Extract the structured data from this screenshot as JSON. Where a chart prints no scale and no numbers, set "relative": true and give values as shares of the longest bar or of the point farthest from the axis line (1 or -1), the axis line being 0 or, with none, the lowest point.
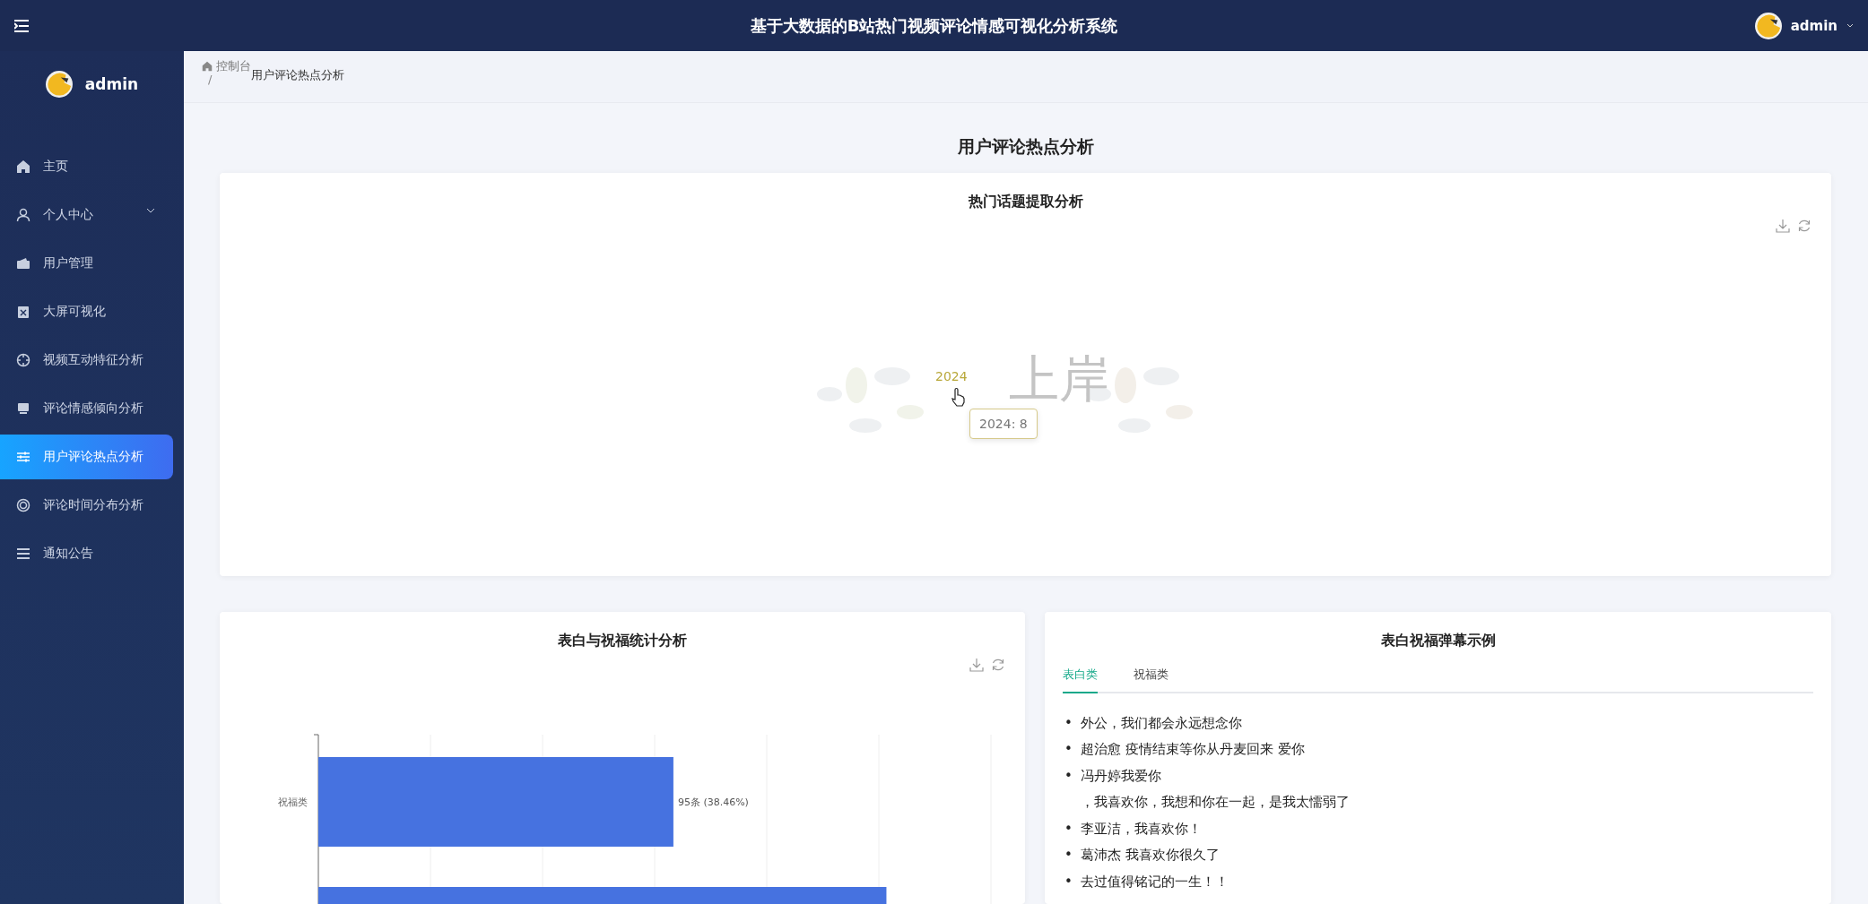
{
  "header": {
    "title": "基于大数据的B站热门视频评论情感可视化分析系统",
    "user": "admin"
  },
  "sidebar": {
    "user": "admin",
    "items": [
      {
        "label": "主页",
        "selected": false
      },
      {
        "label": "个人中心",
        "selected": false,
        "expandable": true
      },
      {
        "label": "用户管理",
        "selected": false
      },
      {
        "label": "大屏可视化",
        "selected": false
      },
      {
        "label": "视频互动特征分析",
        "selected": false
      },
      {
        "label": "评论情感倾向分析",
        "selected": false
      },
      {
        "label": "用户评论热点分析",
        "selected": true
      },
      {
        "label": "评论时间分布分析",
        "selected": false
      },
      {
        "label": "通知公告",
        "selected": false
      }
    ]
  },
  "breadcrumb": {
    "home": "控制台",
    "separator": "/",
    "current": "用户评论热点分析"
  },
  "page_title": "用户评论热点分析",
  "word_cloud_card": {
    "title": "热门话题提取分析",
    "words": [
      {
        "text": "2024",
        "highlighted": true
      },
      {
        "text": "上岸",
        "highlighted": false
      }
    ],
    "tooltip": "2024: 8"
  },
  "bar_card": {
    "title": "表白与祝福统计分析",
    "chart_data": {
      "type": "bar",
      "orientation": "horizontal",
      "categories": [
        "祝福类",
        null
      ],
      "series": [
        {
          "color": "#4672e0",
          "values": [
            0.625,
            1
          ]
        }
      ],
      "relative": true,
      "value_labels": [
        "95条 (38.46%)",
        null
      ]
    }
  },
  "danmaku_card": {
    "title": "表白祝福弹幕示例",
    "tabs": [
      {
        "label": "表白类",
        "selected": true
      },
      {
        "label": "祝福类",
        "selected": false
      }
    ],
    "items": [
      {
        "marker": "•",
        "text": "外公，我们都会永远想念你"
      },
      {
        "marker": "•",
        "text": "超治愈 疫情结束等你从丹麦回来 爱你"
      },
      {
        "marker": "•",
        "text": "冯丹婷我爱你"
      },
      {
        "text": "，我喜欢你，我想和你在一起，是我太懦弱了"
      },
      {
        "marker": "•",
        "text": "李亚洁，我喜欢你！"
      },
      {
        "marker": "•",
        "text": "葛沛杰 我喜欢你很久了"
      },
      {
        "marker": "•",
        "text": "去过值得铭记的一生！！"
      }
    ]
  }
}
